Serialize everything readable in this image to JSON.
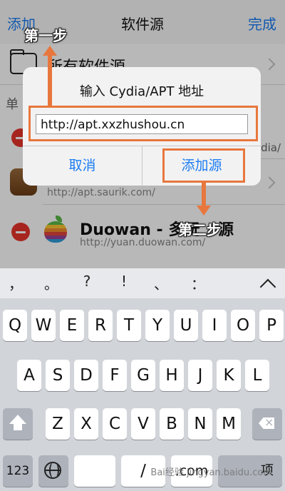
{
  "nav": {
    "add": "添加",
    "title": "软件源",
    "done": "完成"
  },
  "sources": {
    "all_label": "所有软件源",
    "section_label": "单",
    "row_partial": "ydia/",
    "saurik_url": "http://apt.saurik.com/",
    "duowan_title": "Duowan - 多玩",
    "duowan_title_tail": "源",
    "duowan_url": "http://yuan.duowan.com/"
  },
  "dialog": {
    "title": "输入 Cydia/APT 地址",
    "url_value": "http://apt.xxzhushou.cn",
    "cancel": "取消",
    "add_source": "添加源"
  },
  "annotations": {
    "step1": "第一步",
    "step2": "第二步",
    "accent": "#e8773d"
  },
  "keyboard": {
    "suggestions": [
      "，",
      "。",
      "?",
      "!",
      "、",
      "："
    ],
    "row1": [
      "Q",
      "W",
      "E",
      "R",
      "T",
      "Y",
      "U",
      "I",
      "O",
      "P"
    ],
    "row2": [
      "A",
      "S",
      "D",
      "F",
      "G",
      "H",
      "J",
      "K",
      "L"
    ],
    "row3": [
      "Z",
      "X",
      "C",
      "V",
      "B",
      "N",
      "M"
    ],
    "num": "123",
    "slash": "/",
    "com": ".com",
    "last": "项"
  },
  "watermark": "Bai经验\njingyan.baidu.com",
  "icons": [
    "folder-icon",
    "delete-icon",
    "chevron-right-icon",
    "saurik-app-icon",
    "apple-logo-icon",
    "shift-icon",
    "backspace-icon",
    "globe-icon",
    "chevron-up-icon"
  ]
}
